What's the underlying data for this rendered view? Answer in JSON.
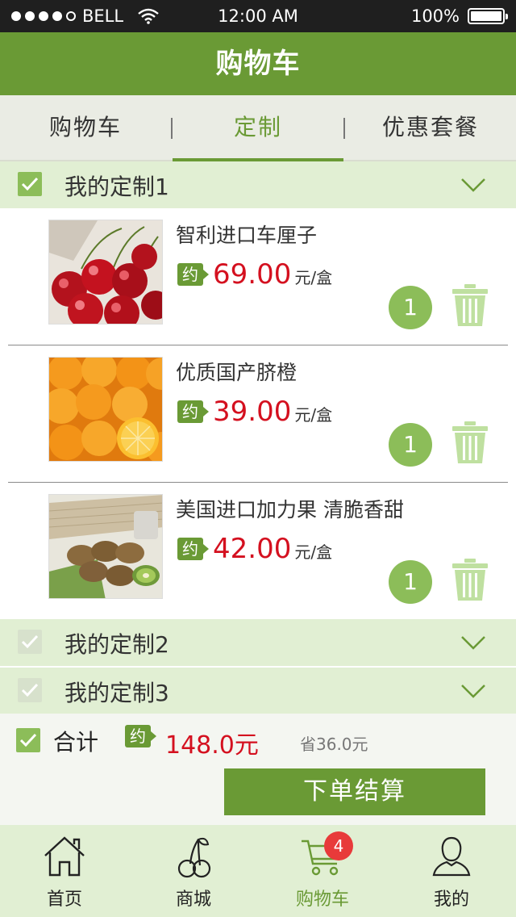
{
  "status_bar": {
    "carrier": "BELL",
    "time": "12:00 AM",
    "battery": "100%"
  },
  "nav": {
    "title": "购物车"
  },
  "tabs": [
    {
      "label": "购物车"
    },
    {
      "label": "定制"
    },
    {
      "label": "优惠套餐"
    }
  ],
  "groups": [
    {
      "title": "我的定制1",
      "checked": true
    },
    {
      "title": "我的定制2",
      "checked": false
    },
    {
      "title": "我的定制3",
      "checked": false
    }
  ],
  "items": [
    {
      "name": "智利进口车厘子",
      "approx": "约",
      "price": "69.00",
      "unit": "元/盒",
      "qty": "1",
      "image": "cherries"
    },
    {
      "name": "优质国产脐橙",
      "approx": "约",
      "price": "39.00",
      "unit": "元/盒",
      "qty": "1",
      "image": "oranges"
    },
    {
      "name": "美国进口加力果 清脆香甜",
      "approx": "约",
      "price": "42.00",
      "unit": "元/盒",
      "qty": "1",
      "image": "kiwi"
    }
  ],
  "summary": {
    "label": "合计",
    "approx": "约",
    "total": "148.0元",
    "saved": "省36.0元",
    "checkout": "下单结算"
  },
  "tabbar": [
    {
      "label": "首页",
      "icon": "home-icon"
    },
    {
      "label": "商城",
      "icon": "cherry-icon"
    },
    {
      "label": "购物车",
      "icon": "cart-icon",
      "badge": "4"
    },
    {
      "label": "我的",
      "icon": "user-icon"
    }
  ],
  "colors": {
    "primary": "#6a9a35",
    "light_green": "#8cbd59",
    "price_red": "#d4101f",
    "badge_red": "#e83a3a"
  }
}
